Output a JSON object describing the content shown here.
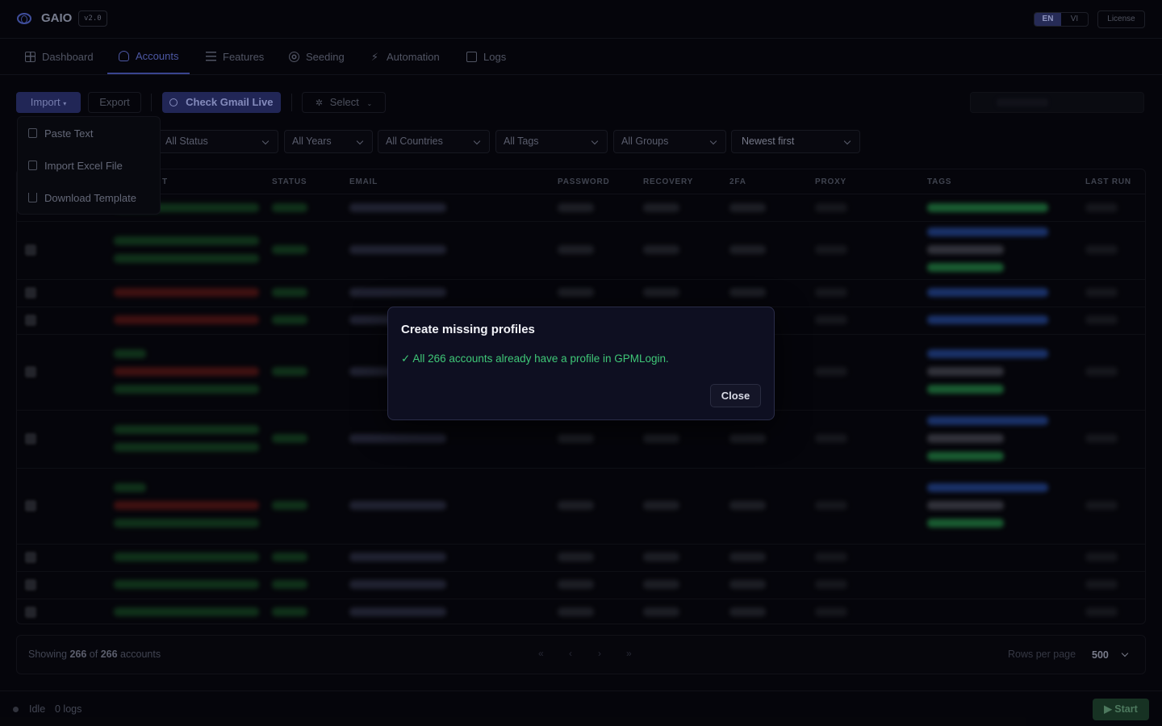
{
  "header": {
    "app_name": "GAIO",
    "version": "v2.0",
    "languages": [
      "EN",
      "VI"
    ],
    "active_language": "EN",
    "license_label": "License"
  },
  "nav": {
    "tabs": [
      {
        "label": "Dashboard",
        "icon": "grid-icon"
      },
      {
        "label": "Accounts",
        "icon": "users-icon",
        "active": true
      },
      {
        "label": "Features",
        "icon": "sliders-icon"
      },
      {
        "label": "Seeding",
        "icon": "target-icon"
      },
      {
        "label": "Automation",
        "icon": "bolt-icon"
      },
      {
        "label": "Logs",
        "icon": "logs-icon"
      }
    ]
  },
  "toolbar": {
    "import_label": "Import",
    "export_label": "Export",
    "check_gmail_label": "Check Gmail Live",
    "select_label": "Select"
  },
  "import_menu": {
    "items": [
      {
        "label": "Paste Text",
        "icon": "clipboard-icon"
      },
      {
        "label": "Import Excel File",
        "icon": "file-icon"
      },
      {
        "label": "Download Template",
        "icon": "download-icon"
      }
    ]
  },
  "filters": {
    "status": "All Status",
    "years": "All Years",
    "countries": "All Countries",
    "tags": "All Tags",
    "groups": "All Groups",
    "sort": "Newest first"
  },
  "table": {
    "headers": [
      "T",
      "STATUS",
      "EMAIL",
      "PASSWORD",
      "RECOVERY",
      "2FA",
      "PROXY",
      "TAGS",
      "LAST RUN"
    ]
  },
  "pagination": {
    "showing_prefix": "Showing",
    "shown_count": "266",
    "of_label": "of",
    "total_count": "266",
    "accounts_label": "accounts",
    "rows_per_page_label": "Rows per page",
    "rows_per_page_value": "500"
  },
  "statusbar": {
    "state": "Idle",
    "logs_count": "0 logs",
    "start_label": "▶ Start"
  },
  "modal": {
    "title": "Create missing profiles",
    "message": "✓ All 266 accounts already have a profile in GPMLogin.",
    "close_label": "Close"
  },
  "colors": {
    "accent": "#4451a8",
    "success": "#3fc777",
    "background": "#07070d",
    "modal_bg": "#0e0f21"
  }
}
